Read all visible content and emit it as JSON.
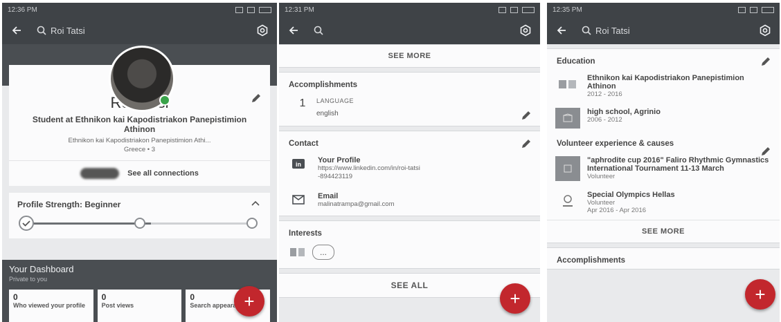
{
  "colors": {
    "toolbar": "#3f4347",
    "header": "#4a4e52",
    "background": "#e9eaec",
    "card": "#fbfbfc",
    "fab": "#c2272d",
    "online": "#3aa34a"
  },
  "icons": {
    "back": "arrow-left-icon",
    "search": "search-icon",
    "settings": "gear-icon",
    "edit": "pencil-icon",
    "add": "plus-icon"
  },
  "p1": {
    "status_time": "12:36 PM",
    "search_text": "Roi Tatsi",
    "name": "Roi Tatsi",
    "headline": "Student at Ethnikon kai Kapodistriakon Panepistimion Athinon",
    "school": "Ethnikon kai Kapodistriakon Panepistimion Athi...",
    "location": "Greece • 3",
    "see_connections": "See all connections",
    "strength_title": "Profile Strength: Beginner",
    "strength_level": 0.55,
    "dashboard_title": "Your Dashboard",
    "dashboard_sub": "Private to you",
    "stats": [
      {
        "num": "0",
        "label": "Who viewed your profile"
      },
      {
        "num": "0",
        "label": "Post views"
      },
      {
        "num": "0",
        "label": "Search appearances"
      }
    ],
    "fab": "+"
  },
  "p2": {
    "status_time": "12:31 PM",
    "see_more": "SEE MORE",
    "accomplishments": {
      "title": "Accomplishments",
      "count": "1",
      "label": "LANGUAGE",
      "value": "english"
    },
    "contact": {
      "title": "Contact",
      "profile_title": "Your Profile",
      "profile_url": "https://www.linkedin.com/in/roi-tatsi",
      "profile_url2": "-894423119",
      "email_title": "Email",
      "email_value": "malinatrampa@gmail.com"
    },
    "interests": {
      "title": "Interests",
      "more": "..."
    },
    "see_all": "SEE ALL",
    "fab": "+"
  },
  "p3": {
    "status_time": "12:35 PM",
    "search_text": "Roi Tatsi",
    "education": {
      "title": "Education",
      "items": [
        {
          "title": "Ethnikon kai Kapodistriakon Panepistimion Athinon",
          "dates": "2012 - 2016"
        },
        {
          "title": "high school, Agrinio",
          "dates": "2006 - 2012"
        }
      ]
    },
    "volunteer": {
      "title": "Volunteer experience & causes",
      "items": [
        {
          "title": "\"aphrodite cup 2016\" Faliro Rhythmic Gymnastics International Tournament 11-13 March",
          "role": "Volunteer",
          "dates": ""
        },
        {
          "title": "Special Olympics Hellas",
          "role": "Volunteer",
          "dates": "Apr 2016 - Apr 2016"
        }
      ]
    },
    "see_more": "SEE MORE",
    "accomplishments_title": "Accomplishments",
    "fab": "+"
  }
}
